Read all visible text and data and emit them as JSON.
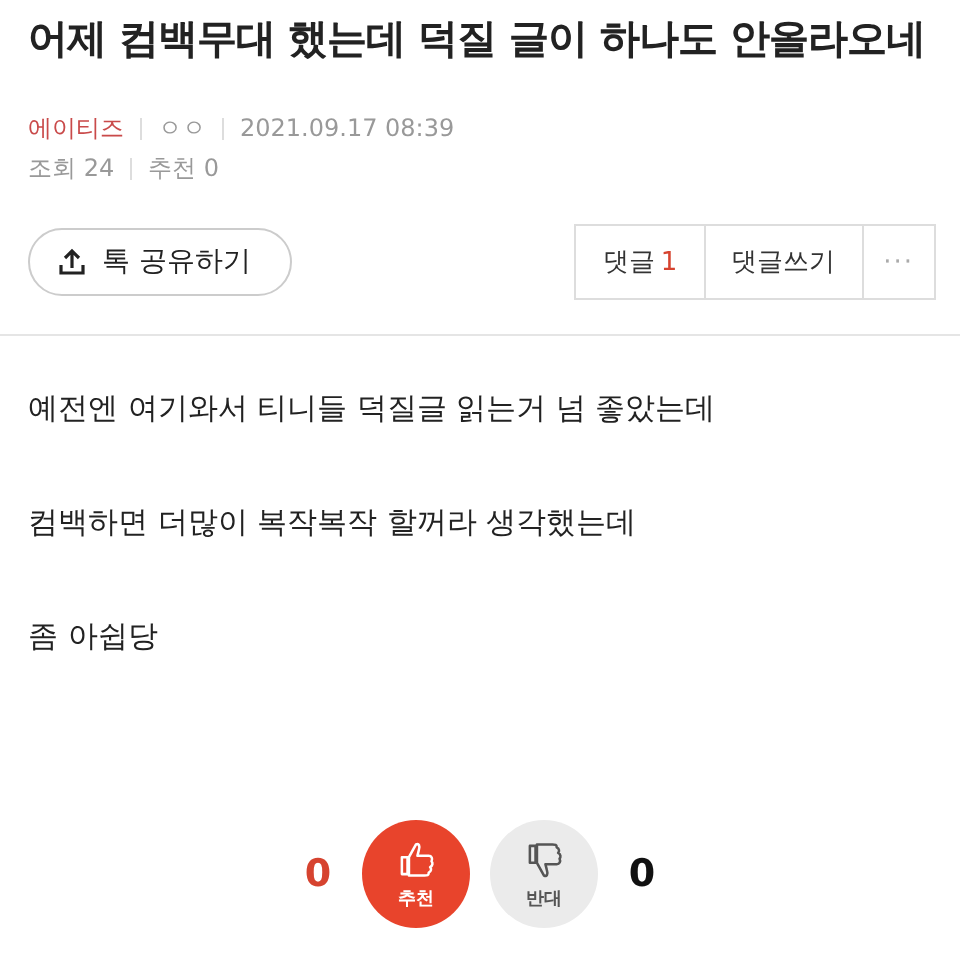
{
  "title": "어제 컴백무대 했는데 덕질 글이 하나도 안올라오네",
  "meta": {
    "author": "에이티즈",
    "nickname": "ㅇㅇ",
    "date": "2021.09.17 08:39",
    "views": "조회 24",
    "recommends": "추천 0"
  },
  "share_button": "톡 공유하기",
  "comments_button": {
    "label": "댓글",
    "count": "1"
  },
  "write_comment_button": "댓글쓰기",
  "more_button": "···",
  "body": [
    "예전엔 여기와서 티니들 덕질글 읽는거 넘 좋았는데",
    "컴백하면 더많이 복작복작 할꺼라 생각했는데",
    "좀 아쉽당"
  ],
  "votes": [
    {
      "kind": "up",
      "label": "추천",
      "count": "0"
    },
    {
      "kind": "down",
      "label": "반대",
      "count": "0"
    }
  ]
}
